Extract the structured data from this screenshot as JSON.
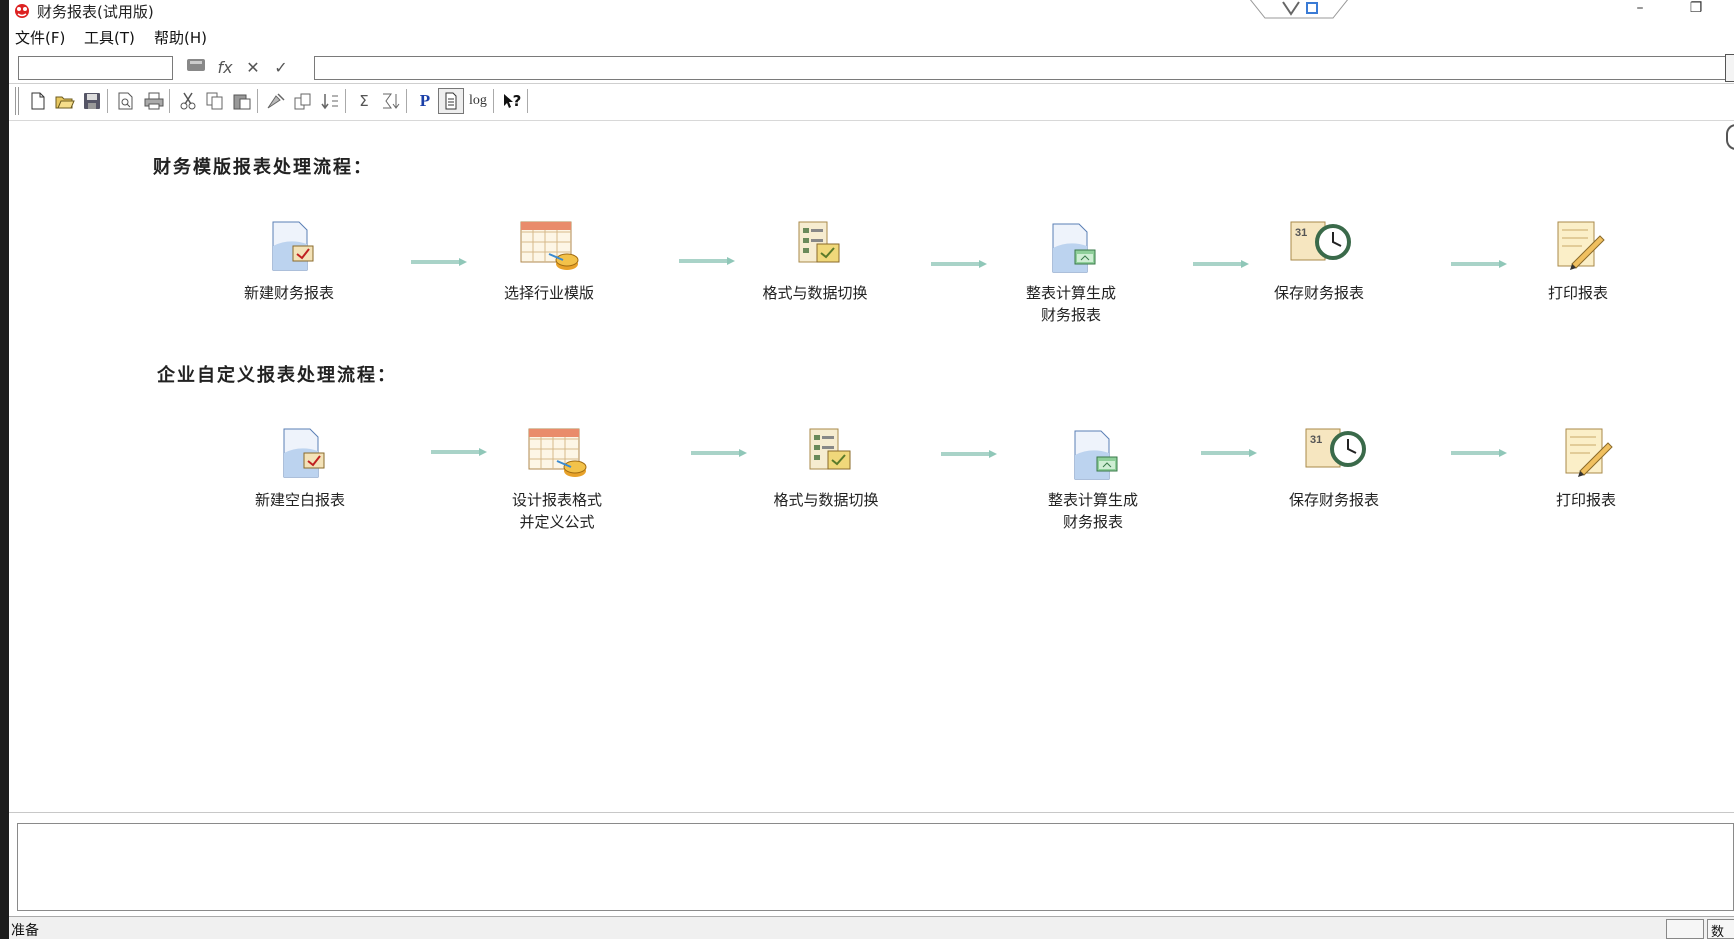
{
  "window": {
    "title": "财务报表(试用版)",
    "minimize_glyph": "–",
    "restore_glyph": "❐"
  },
  "menu": [
    {
      "label": "文件(F)"
    },
    {
      "label": "工具(T)"
    },
    {
      "label": "帮助(H)"
    }
  ],
  "formula_bar": {
    "cell_ref_value": "",
    "formula_value": "",
    "icons": [
      "save-cell-icon",
      "fx-icon",
      "cancel-x-icon",
      "confirm-check-icon"
    ],
    "fx_glyph": "fx",
    "cancel_glyph": "✕",
    "confirm_glyph": "✓"
  },
  "toolbar": {
    "buttons": [
      "new-file-icon",
      "open-folder-icon",
      "save-icon",
      "print-preview-icon",
      "print-icon",
      "cut-icon",
      "copy-icon",
      "paste-icon",
      "fill-icon",
      "format-icon",
      "sort-icon",
      "sum-icon",
      "sum-sort-icon",
      "p-icon",
      "page-icon",
      "log-icon",
      "help-pointer-icon"
    ],
    "p_glyph": "P",
    "log_glyph": "log",
    "help_glyph": "?",
    "sum_glyph": "Σ"
  },
  "workflow": {
    "template_title": "财务模版报表处理流程：",
    "template_steps": [
      {
        "label": "新建财务报表",
        "icon": "new-report-icon"
      },
      {
        "label": "选择行业模版",
        "icon": "template-select-icon"
      },
      {
        "label": "格式与数据切换",
        "icon": "format-data-switch-icon"
      },
      {
        "label": "整表计算生成\n财务报表",
        "icon": "calculate-report-icon"
      },
      {
        "label": "保存财务报表",
        "icon": "save-report-clock-icon"
      },
      {
        "label": "打印报表",
        "icon": "print-report-icon"
      }
    ],
    "custom_title": "企业自定义报表处理流程：",
    "custom_steps": [
      {
        "label": "新建空白报表",
        "icon": "new-blank-report-icon"
      },
      {
        "label": "设计报表格式\n并定义公式",
        "icon": "design-format-icon"
      },
      {
        "label": "格式与数据切换",
        "icon": "format-data-switch-icon"
      },
      {
        "label": "整表计算生成\n财务报表",
        "icon": "calculate-report-icon"
      },
      {
        "label": "保存财务报表",
        "icon": "save-report-clock-icon"
      },
      {
        "label": "打印报表",
        "icon": "print-report-icon"
      }
    ]
  },
  "status": {
    "text": "准备",
    "num_lock": "数字"
  },
  "colors": {
    "accent": "#3a6fb5",
    "arrow": "#8fc7b8",
    "frame": "#1c1c1c"
  }
}
